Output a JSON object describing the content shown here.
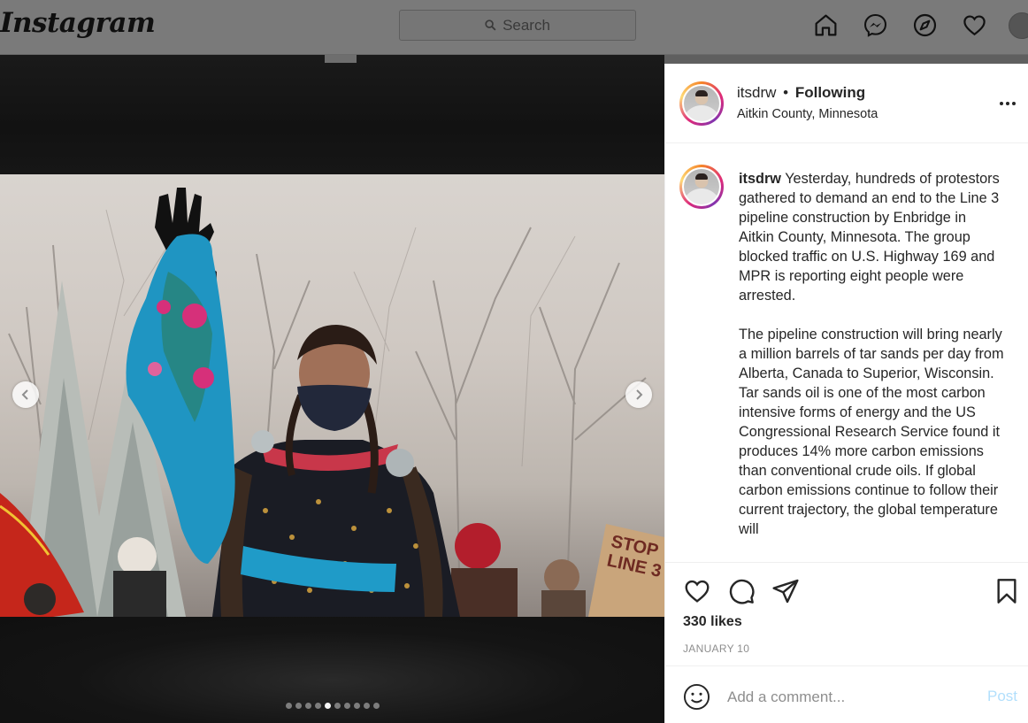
{
  "topnav": {
    "logo": "Instagram",
    "search_placeholder": "Search"
  },
  "media": {
    "slide_count": 10,
    "active_slide": 5,
    "sign_text_line1": "STOP",
    "sign_text_line2": "LINE 3"
  },
  "post": {
    "username": "itsdrw",
    "separator": "•",
    "follow_status": "Following",
    "location": "Aitkin County, Minnesota",
    "caption_username": "itsdrw",
    "caption_paragraphs": [
      "Yesterday, hundreds of protestors gathered to demand an end to the Line 3 pipeline construction by Enbridge in Aitkin County, Minnesota. The group blocked traffic on U.S. Highway 169 and MPR is reporting eight people were arrested.",
      "The pipeline construction will bring nearly a million barrels of tar sands per day from Alberta, Canada to Superior, Wisconsin. Tar sands oil is one of the most carbon intensive forms of energy and the US Congressional Research Service found it produces 14% more carbon emissions than conventional crude oils. If global carbon emissions continue to follow their current trajectory, the global temperature will"
    ],
    "likes": "330 likes",
    "date": "JANUARY 10",
    "comment_placeholder": "Add a comment...",
    "post_label": "Post"
  },
  "colors": {
    "accent_post": "#b2dffc",
    "text": "#262626",
    "muted": "#8e8e8e"
  }
}
